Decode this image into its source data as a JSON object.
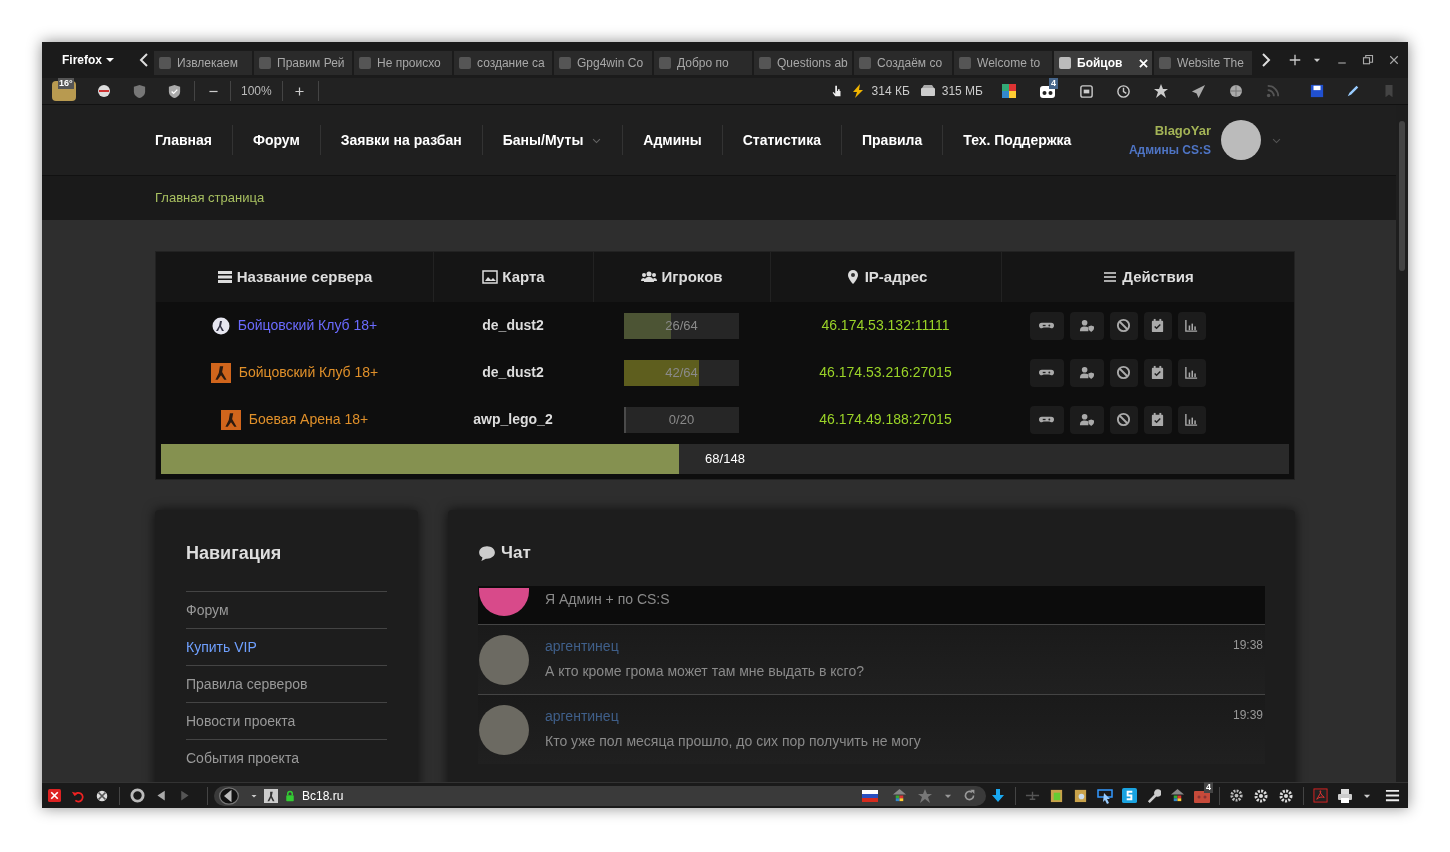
{
  "browser": {
    "menu_button": "Firefox",
    "tabs": [
      {
        "title": "Извлекаем",
        "selected": false
      },
      {
        "title": "Правим Рей",
        "selected": false
      },
      {
        "title": "Не происхо",
        "selected": false
      },
      {
        "title": "создание са",
        "selected": false
      },
      {
        "title": "Gpg4win Co",
        "selected": false
      },
      {
        "title": "Добро по",
        "selected": false
      },
      {
        "title": "Questions ab",
        "selected": false
      },
      {
        "title": "Создаём со",
        "selected": false
      },
      {
        "title": "Welcome to",
        "selected": false
      },
      {
        "title": "Бойцов",
        "selected": true
      },
      {
        "title": "Website The",
        "selected": false
      }
    ],
    "toolbar": {
      "weather": "16°",
      "zoom": "100%",
      "traffic": "314 КБ",
      "memory": "315 МБ",
      "notification_count": "4"
    },
    "status_bar": {
      "address": "Bc18.ru",
      "notification_count": "4"
    }
  },
  "site": {
    "nav": [
      {
        "label": "Главная",
        "dropdown": false
      },
      {
        "label": "Форум",
        "dropdown": false
      },
      {
        "label": "Заявки на разбан",
        "dropdown": false
      },
      {
        "label": "Баны/Муты",
        "dropdown": true
      },
      {
        "label": "Админы",
        "dropdown": false
      },
      {
        "label": "Статистика",
        "dropdown": false
      },
      {
        "label": "Правила",
        "dropdown": false
      },
      {
        "label": "Тех. Поддержка",
        "dropdown": false
      }
    ],
    "user": {
      "name": "BlagoYar",
      "role": "Админы CS:S"
    },
    "breadcrumb": "Главная страница"
  },
  "servers": {
    "columns": [
      "Название сервера",
      "Карта",
      "Игроков",
      "IP-адрес",
      "Действия"
    ],
    "rows": [
      {
        "name": "Бойцовский Клуб 18+",
        "kind": "circle",
        "color": "#6b6bff",
        "map": "de_dust2",
        "players": "26/64",
        "level": 0.406,
        "ip": "46.174.53.132:11111"
      },
      {
        "name": "Бойцовский Клуб 18+",
        "kind": "square",
        "color": "#e0902a",
        "map": "de_dust2",
        "players": "42/64",
        "level": 0.656,
        "ip": "46.174.53.216:27015"
      },
      {
        "name": "Боевая Арена 18+",
        "kind": "square",
        "color": "#e0902a",
        "map": "awp_lego_2",
        "players": "0/20",
        "level": 0,
        "ip": "46.174.49.188:27015"
      }
    ],
    "total": {
      "text": "68/148",
      "level": 0.459
    }
  },
  "navigation": {
    "title": "Навигация",
    "items": [
      {
        "label": "Форум",
        "selected": false
      },
      {
        "label": "Купить VIP",
        "selected": true
      },
      {
        "label": "Правила серверов",
        "selected": false
      },
      {
        "label": "Новости проекта",
        "selected": false
      },
      {
        "label": "События проекта",
        "selected": false
      }
    ]
  },
  "chat": {
    "title": "Чат",
    "messages": [
      {
        "text": "Я Админ + по CS:S"
      },
      {
        "author": "аргентинец",
        "text": "А кто кроме грома может там мне выдать в ксго?",
        "time": "19:38"
      },
      {
        "author": "аргентинец",
        "text": "Кто уже пол месяца прошло, до сих пор получить не могу",
        "time": "19:39"
      }
    ]
  }
}
